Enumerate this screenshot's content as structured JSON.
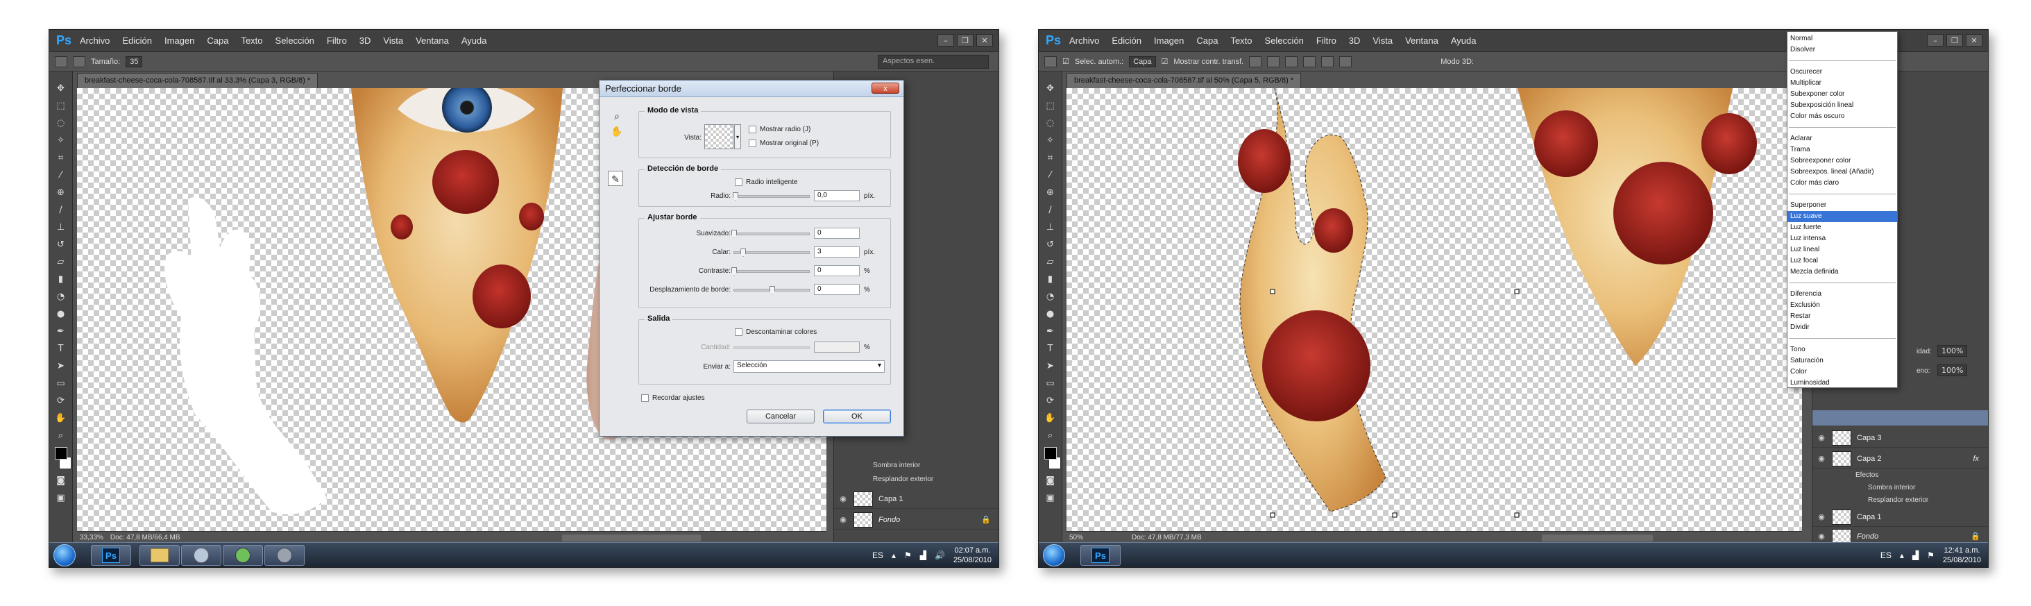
{
  "screens": [
    {
      "menu": [
        "Archivo",
        "Edición",
        "Imagen",
        "Capa",
        "Texto",
        "Selección",
        "Filtro",
        "3D",
        "Vista",
        "Ventana",
        "Ayuda"
      ],
      "options": {
        "size_label": "Tamaño:",
        "size_value": "35"
      },
      "workspace": "Aspectos esen.",
      "document_tab": "breakfast-cheese-coca-cola-708587.tif al 33,3% (Capa 3, RGB/8) *",
      "status": {
        "zoom": "33,33%",
        "doc": "Doc: 47,8 MB/66,4 MB"
      },
      "layers": [
        {
          "name": "Sombra interior",
          "type": "effect"
        },
        {
          "name": "Resplandor exterior",
          "type": "effect"
        },
        {
          "name": "Capa 1",
          "type": "layer"
        },
        {
          "name": "Fondo",
          "type": "layer"
        }
      ],
      "clock": {
        "time": "02:07 a.m.",
        "date": "25/08/2010"
      },
      "lang": "ES"
    },
    {
      "menu": [
        "Archivo",
        "Edición",
        "Imagen",
        "Capa",
        "Texto",
        "Selección",
        "Filtro",
        "3D",
        "Vista",
        "Ventana",
        "Ayuda"
      ],
      "options": {
        "auto_select": "Selec. autom.:",
        "auto_select_value": "Capa",
        "show_transform": "Mostrar contr. transf.",
        "mode3d": "Modo 3D:"
      },
      "document_tab": "breakfast-cheese-coca-cola-708587.tif al 50% (Capa 5, RGB/8) *",
      "status": {
        "zoom": "50%",
        "doc": "Doc: 47,8 MB/77,3 MB"
      },
      "panel_opacity": {
        "fill_label": "idad:",
        "fill_value": "100%",
        "opacity_label": "eno:",
        "opacity_value": "100%"
      },
      "layers": [
        {
          "name": "Capa 3",
          "type": "layer"
        },
        {
          "name": "Capa 2",
          "type": "layer",
          "fx": "fx"
        },
        {
          "name": "Efectos",
          "type": "effect-group"
        },
        {
          "name": "Sombra interior",
          "type": "effect"
        },
        {
          "name": "Resplandor exterior",
          "type": "effect"
        },
        {
          "name": "Capa 1",
          "type": "layer"
        },
        {
          "name": "Fondo",
          "type": "layer"
        }
      ],
      "clock": {
        "time": "12:41 a.m.",
        "date": "25/08/2010"
      },
      "lang": "ES"
    }
  ],
  "dialog": {
    "title": "Perfeccionar borde",
    "close": "x",
    "view_mode": {
      "title": "Modo de vista",
      "view_label": "Vista:",
      "show_radius": "Mostrar radio (J)",
      "show_original": "Mostrar original (P)"
    },
    "edge_detection": {
      "title": "Detección de borde",
      "smart_radius": "Radio inteligente",
      "radius_label": "Radio:",
      "radius_value": "0,0",
      "radius_unit": "píx."
    },
    "adjust_edge": {
      "title": "Ajustar borde",
      "rows": [
        {
          "label": "Suavizado:",
          "value": "0",
          "unit": "",
          "knob": 0.0
        },
        {
          "label": "Calar:",
          "value": "3",
          "unit": "píx.",
          "knob": 0.12
        },
        {
          "label": "Contraste:",
          "value": "0",
          "unit": "%",
          "knob": 0.0
        },
        {
          "label": "Desplazamiento de borde:",
          "value": "0",
          "unit": "%",
          "knob": 0.5
        }
      ]
    },
    "output": {
      "title": "Salida",
      "decontaminate": "Descontaminar colores",
      "amount_label": "Cantidad:",
      "amount_unit": "%",
      "send_to_label": "Enviar a:",
      "send_to_value": "Selección"
    },
    "remember": "Recordar ajustes",
    "cancel": "Cancelar",
    "ok": "OK"
  },
  "blend_menu": {
    "groups": [
      [
        "Normal",
        "Disolver"
      ],
      [
        "Oscurecer",
        "Multiplicar",
        "Subexponer color",
        "Subexposición lineal",
        "Color más oscuro"
      ],
      [
        "Aclarar",
        "Trama",
        "Sobreexponer color",
        "Sobreexpos. lineal (Añadir)",
        "Color más claro"
      ],
      [
        "Superponer",
        "Luz suave",
        "Luz fuerte",
        "Luz intensa",
        "Luz lineal",
        "Luz focal",
        "Mezcla definida"
      ],
      [
        "Diferencia",
        "Exclusión",
        "Restar",
        "Dividir"
      ],
      [
        "Tono",
        "Saturación",
        "Color",
        "Luminosidad"
      ]
    ],
    "selected": "Luz suave"
  },
  "colors": {
    "ps_blue": "#31a8ff",
    "menu_bg": "#404040",
    "panel_bg": "#474747",
    "dialog_bg": "#e7e8eb",
    "selection_blue": "#3875d7"
  }
}
